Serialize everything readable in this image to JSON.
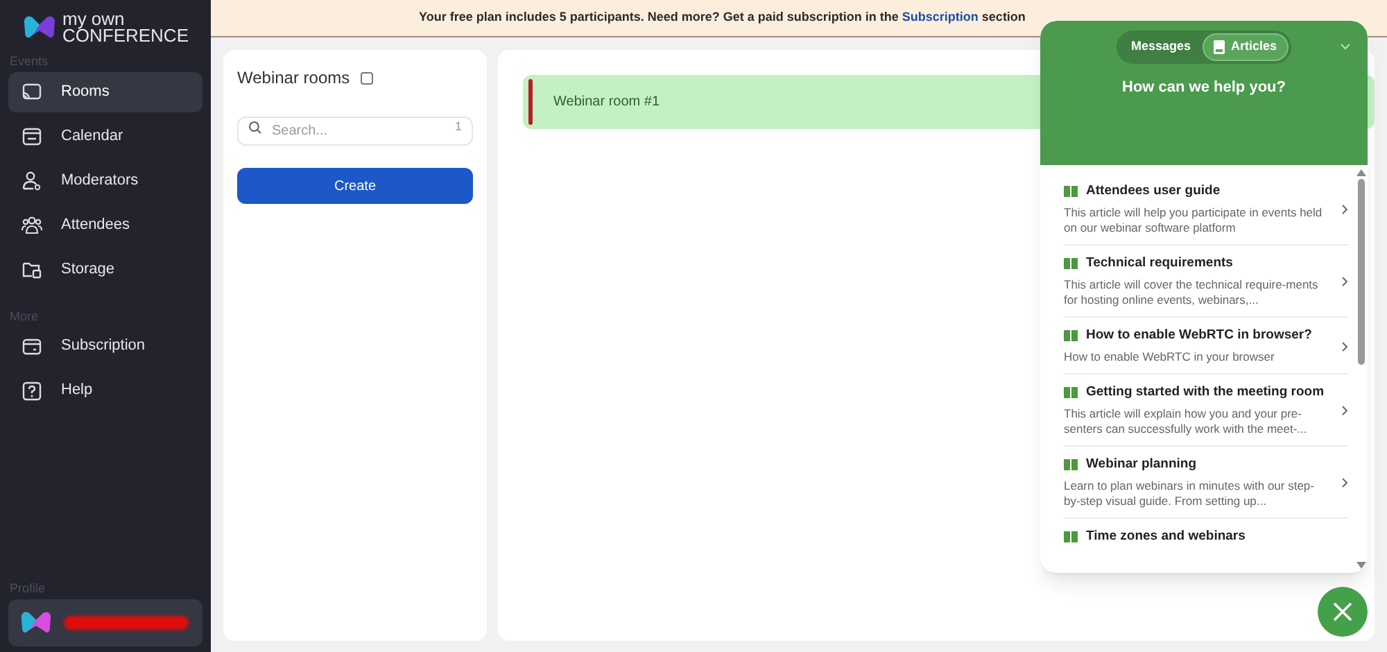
{
  "logo": {
    "line_1": "my own",
    "line_2": "CONFERENCE"
  },
  "sidebar": {
    "sections": [
      {
        "title": "Events",
        "items": [
          {
            "label": "Rooms",
            "selected": true
          },
          {
            "label": "Calendar",
            "selected": false
          },
          {
            "label": "Moderators",
            "selected": false
          },
          {
            "label": "Attendees",
            "selected": false
          },
          {
            "label": "Storage",
            "selected": false
          }
        ]
      },
      {
        "title": "More",
        "items": [
          {
            "label": "Subscription",
            "selected": false
          },
          {
            "label": "Help",
            "selected": false
          }
        ]
      }
    ],
    "profile_title": "Profile"
  },
  "banner": {
    "text_before": "Your free plan includes 5 participants. Need more? Get a paid subscription in the",
    "link": "Subscription",
    "text_after": "section"
  },
  "rooms_panel": {
    "title": "Webinar rooms",
    "search_placeholder": "Search...",
    "count": "1",
    "create_button": "Create"
  },
  "rooms": [
    {
      "name": "Webinar room #1"
    }
  ],
  "help_widget": {
    "tabs": [
      {
        "label": "Messages",
        "selected": false
      },
      {
        "label": "Articles",
        "selected": true
      }
    ],
    "heading": "How can we help you?",
    "articles": [
      {
        "title": "Attendees user guide",
        "summary": "This article will help you participate in events held on our webinar software platform"
      },
      {
        "title": "Technical requirements",
        "summary": "This article will cover the technical require-ments for hosting online events, webinars,..."
      },
      {
        "title": "How to enable WebRTC in browser?",
        "summary": "How to enable WebRTC in your browser"
      },
      {
        "title": "Getting started with the meeting room",
        "summary": "This article will explain how you and your pre-senters can successfully work with the meet-..."
      },
      {
        "title": "Webinar planning",
        "summary": "Learn to plan webinars in minutes with our step-by-step visual guide. From setting up..."
      },
      {
        "title": "Time zones and webinars"
      }
    ]
  }
}
